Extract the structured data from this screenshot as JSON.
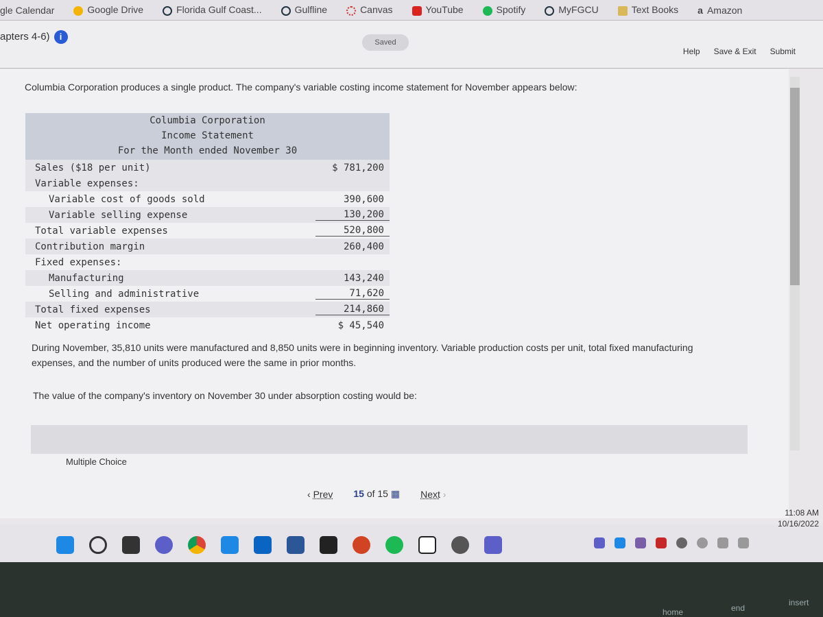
{
  "bookmarks": [
    "gle Calendar",
    "Google Drive",
    "Florida Gulf Coast...",
    "Gulfline",
    "Canvas",
    "YouTube",
    "Spotify",
    "MyFGCU",
    "Text Books",
    "Amazon"
  ],
  "header": {
    "title": "apters 4-6)",
    "info_icon": "i",
    "saved": "Saved",
    "help": "Help",
    "save_exit": "Save & Exit",
    "submit": "Submit"
  },
  "question": {
    "intro": "Columbia Corporation produces a single product. The company's variable costing income statement for November appears below:",
    "statement": {
      "company": "Columbia Corporation",
      "name": "Income Statement",
      "period": "For the Month ended November 30",
      "rows": [
        {
          "label": "Sales ($18 per unit)",
          "value": "$ 781,200"
        },
        {
          "label": "Variable expenses:",
          "value": ""
        },
        {
          "label": "Variable cost of goods sold",
          "value": "390,600"
        },
        {
          "label": "Variable selling expense",
          "value": "130,200"
        },
        {
          "label": "Total variable expenses",
          "value": "520,800"
        },
        {
          "label": "Contribution margin",
          "value": "260,400"
        },
        {
          "label": "Fixed expenses:",
          "value": ""
        },
        {
          "label": "Manufacturing",
          "value": "143,240"
        },
        {
          "label": "Selling and administrative",
          "value": "71,620"
        },
        {
          "label": "Total fixed expenses",
          "value": "214,860"
        },
        {
          "label": "Net operating income",
          "value": "$ 45,540"
        }
      ]
    },
    "detail": "During November, 35,810 units were manufactured and 8,850 units were in beginning inventory. Variable production costs per unit, total fixed manufacturing expenses, and the number of units produced were the same in prior months.",
    "ask": "The value of the company's inventory on November 30 under absorption costing would be:",
    "type": "Multiple Choice"
  },
  "nav": {
    "prev": "Prev",
    "current": "15",
    "of": "of 15",
    "next": "Next"
  },
  "clock": {
    "time": "11:08 AM",
    "date": "10/16/2022"
  },
  "keys": {
    "home": "home",
    "end": "end",
    "insert": "insert"
  },
  "colors": {
    "accent": "#2a5bd7",
    "table_header": "#c9ced9"
  }
}
